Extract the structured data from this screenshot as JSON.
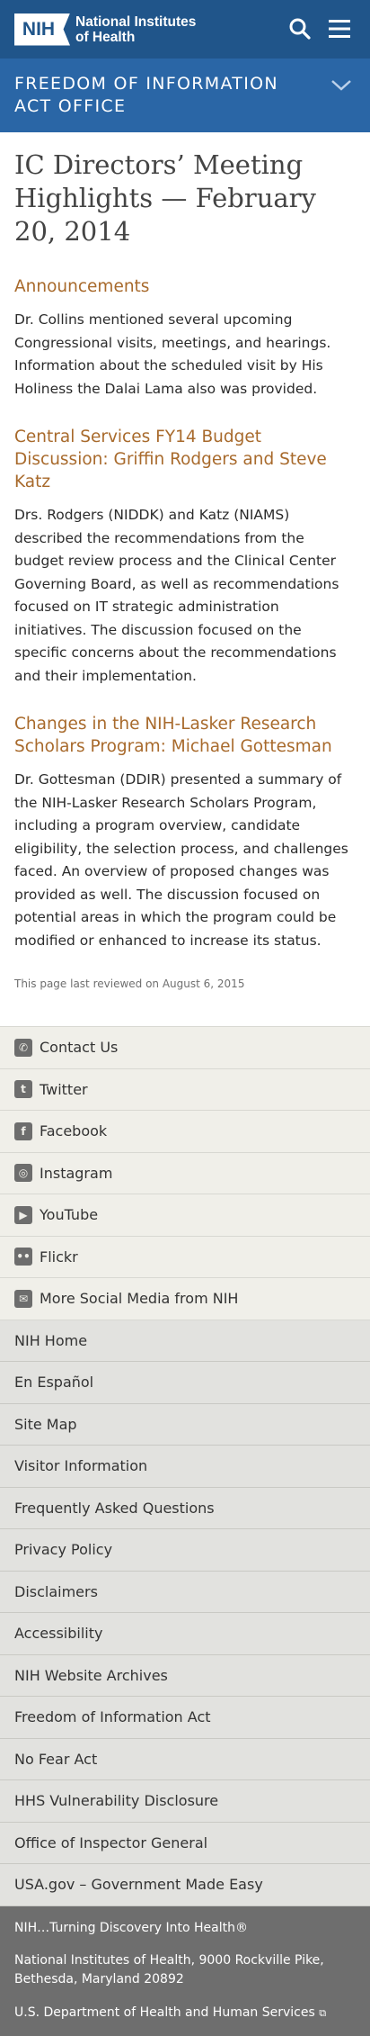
{
  "header": {
    "logo_mark": "NIH",
    "logo_line1": "National Institutes",
    "logo_line2": "of Health",
    "office_title": "FREEDOM OF INFORMATION ACT OFFICE"
  },
  "page": {
    "title": "IC Directors’ Meeting Highlights — February 20, 2014",
    "sections": [
      {
        "heading": "Announcements",
        "body": "Dr. Collins mentioned several upcoming Congressional visits, meetings, and hearings. Information about the scheduled visit by His Holiness the Dalai Lama also was provided."
      },
      {
        "heading": "Central Services FY14 Budget Discussion: Griffin Rodgers and Steve Katz",
        "body": "Drs. Rodgers (NIDDK) and Katz (NIAMS) described the recommendations from the budget review process and the Clinical Center Governing Board, as well as recommendations focused on IT strategic administration initiatives. The discussion focused on the specific concerns about the recommendations and their implementation."
      },
      {
        "heading": "Changes in the NIH-Lasker Research Scholars Program: Michael Gottesman",
        "body": "Dr. Gottesman (DDIR) presented a summary of the NIH-Lasker Research Scholars Program, including a program overview, candidate eligibility, the selection process, and challenges faced. An overview of proposed changes was provided as well. The discussion focused on potential areas in which the program could be modified or enhanced to increase its status."
      }
    ],
    "reviewed": "This page last reviewed on August 6, 2015"
  },
  "footer": {
    "social": [
      {
        "label": "Contact Us",
        "icon": "phone-icon",
        "glyph": "✆"
      },
      {
        "label": "Twitter",
        "icon": "twitter-icon",
        "glyph": "t"
      },
      {
        "label": "Facebook",
        "icon": "facebook-icon",
        "glyph": "f"
      },
      {
        "label": "Instagram",
        "icon": "instagram-icon",
        "glyph": "◎"
      },
      {
        "label": "YouTube",
        "icon": "youtube-icon",
        "glyph": "▶"
      },
      {
        "label": "Flickr",
        "icon": "flickr-icon",
        "glyph": "••"
      },
      {
        "label": "More Social Media from NIH",
        "icon": "social-media-icon",
        "glyph": "✉"
      }
    ],
    "links": [
      "NIH Home",
      "En Español",
      "Site Map",
      "Visitor Information",
      "Frequently Asked Questions",
      "Privacy Policy",
      "Disclaimers",
      "Accessibility",
      "NIH Website Archives",
      "Freedom of Information Act",
      "No Fear Act",
      "HHS Vulnerability Disclosure",
      "Office of Inspector General",
      "USA.gov – Government Made Easy"
    ],
    "tagline": "NIH…Turning Discovery Into Health®",
    "address": "National Institutes of Health, 9000 Rockville Pike, Bethesda, Maryland 20892",
    "hhs": "U.S. Department of Health and Human Services"
  },
  "colors": {
    "header_dark": "#20558a",
    "header_light": "#2a66a6",
    "heading_accent": "#a86a2c"
  }
}
